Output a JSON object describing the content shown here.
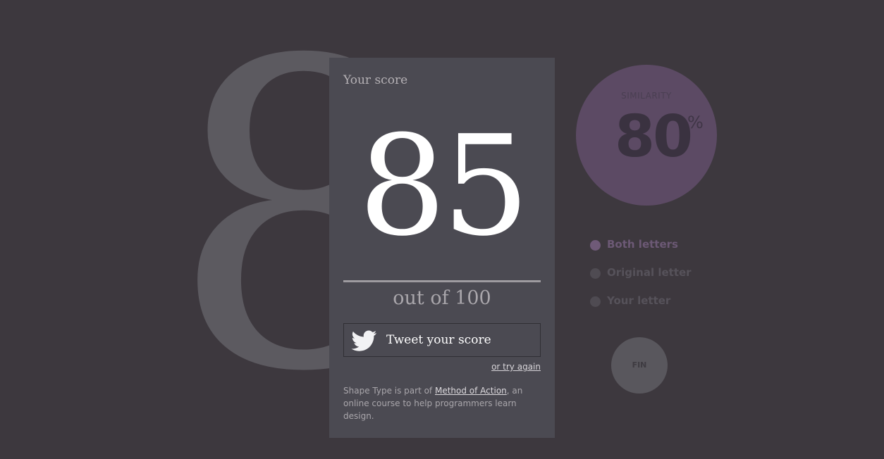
{
  "background_glyph": "8",
  "score_panel": {
    "title": "Your score",
    "score": "85",
    "out_of": "out of 100",
    "tweet_label": "Tweet your score",
    "try_again": "or try again",
    "footer_prefix": "Shape Type is part of ",
    "footer_link": "Method of Action",
    "footer_suffix": ", an online course to help programmers learn design."
  },
  "similarity": {
    "label": "SIMILARITY",
    "value": "80",
    "unit": "%"
  },
  "legend": {
    "items": [
      {
        "label": "Both letters",
        "active": true
      },
      {
        "label": "Original letter",
        "active": false
      },
      {
        "label": "Your letter",
        "active": false
      }
    ]
  },
  "fin_button": {
    "label": "FIN"
  },
  "colors": {
    "background": "#3d383e",
    "panel": "#4b4a52",
    "accent_purple": "#5c4a64",
    "glyph": "#5c5a60"
  },
  "icons": {
    "tweet": "twitter-bird-icon",
    "legend_marker": "circle-dot-icon"
  }
}
